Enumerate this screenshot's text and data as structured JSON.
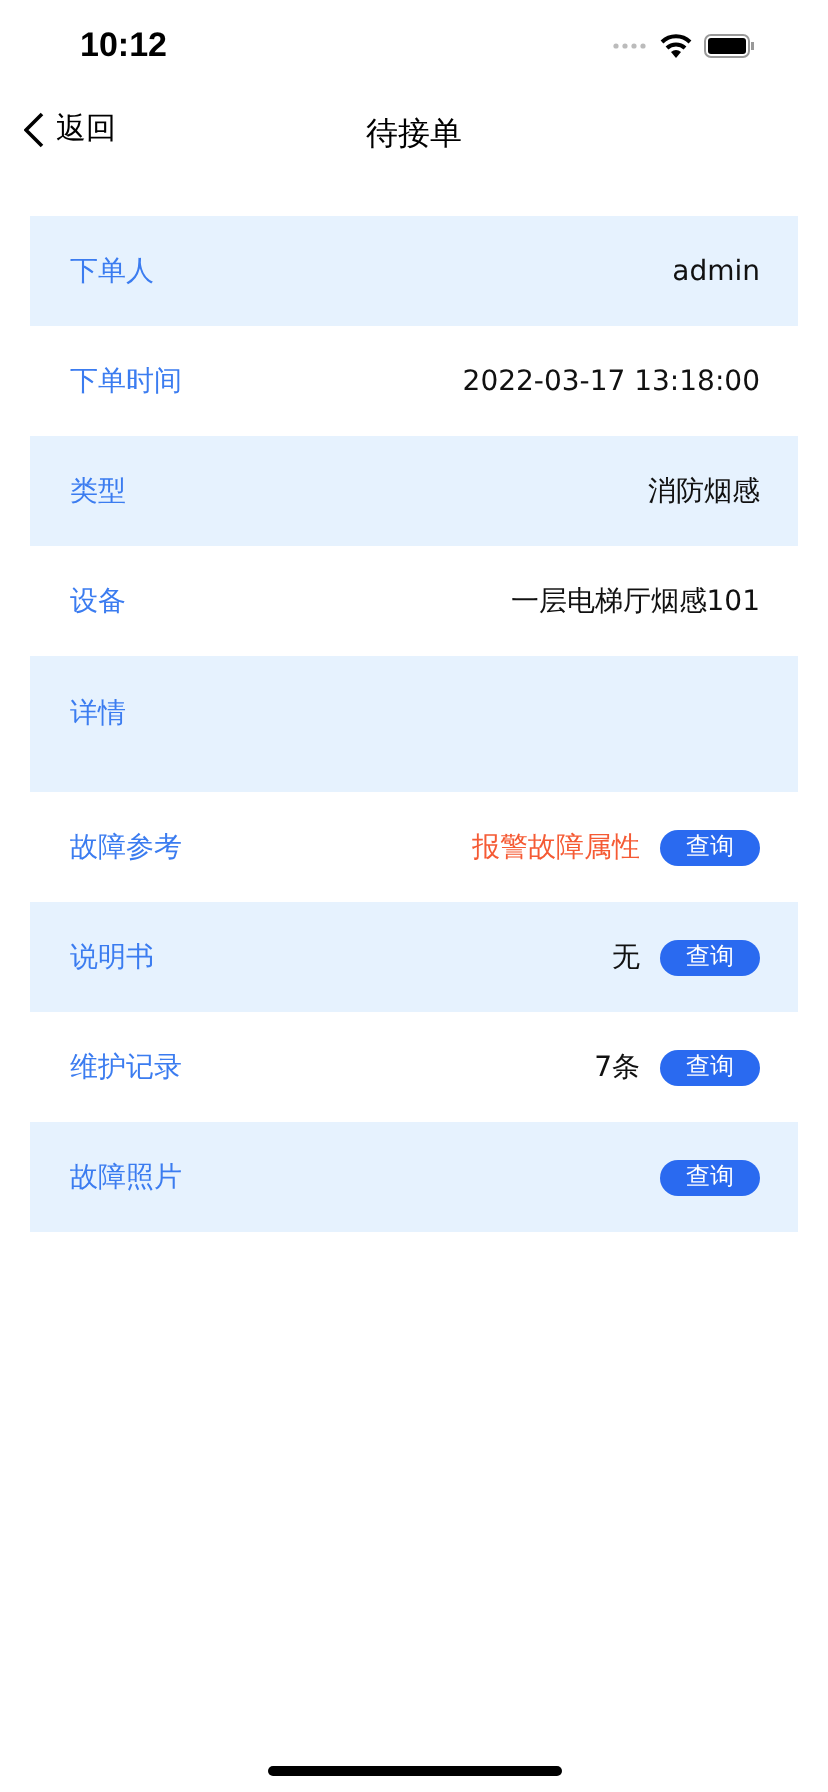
{
  "status_bar": {
    "time": "10:12"
  },
  "nav": {
    "back": "返回",
    "title": "待接单"
  },
  "rows": [
    {
      "kind": "text",
      "label": "下单人",
      "value": "admin"
    },
    {
      "kind": "text",
      "label": "下单时间",
      "value": "2022-03-17 13:18:00"
    },
    {
      "kind": "text",
      "label": "类型",
      "value": "消防烟感"
    },
    {
      "kind": "text",
      "label": "设备",
      "value": "一层电梯厅烟感101"
    },
    {
      "kind": "detail",
      "label": "详情"
    },
    {
      "kind": "action",
      "label": "故障参考",
      "value": "报警故障属性",
      "alert": true,
      "button": "查询"
    },
    {
      "kind": "action",
      "label": "说明书",
      "value": "无",
      "alert": false,
      "button": "查询"
    },
    {
      "kind": "action",
      "label": "维护记录",
      "value": "7条",
      "alert": false,
      "button": "查询"
    },
    {
      "kind": "action",
      "label": "故障照片",
      "button": "查询"
    }
  ]
}
